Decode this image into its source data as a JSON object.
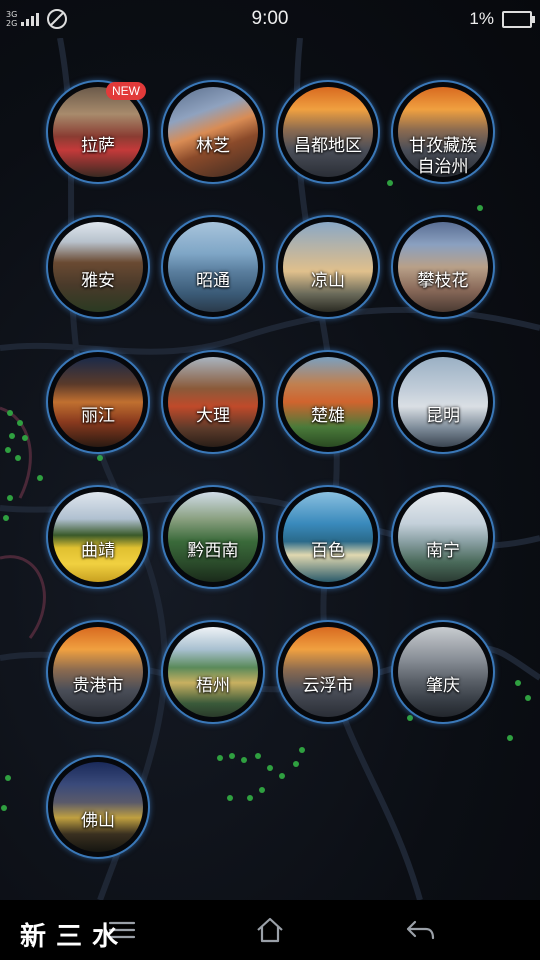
{
  "status_bar": {
    "network_top": "3G",
    "network_bottom": "2G",
    "time": "9:00",
    "battery": "1%",
    "icons": [
      "signal-icon",
      "no-sim-icon",
      "battery-icon"
    ]
  },
  "cities": [
    {
      "name": "拉萨",
      "badge": "NEW",
      "scene": "market"
    },
    {
      "name": "林芝",
      "scene": "mountain"
    },
    {
      "name": "昌都地区",
      "scene": "city"
    },
    {
      "name": "甘孜藏族\n自治州",
      "scene": "city"
    },
    {
      "name": "雅安",
      "scene": "village"
    },
    {
      "name": "昭通",
      "scene": "lake"
    },
    {
      "name": "凉山",
      "scene": "sunsetlake"
    },
    {
      "name": "攀枝花",
      "scene": "town"
    },
    {
      "name": "丽江",
      "scene": "lantern"
    },
    {
      "name": "大理",
      "scene": "oldtown"
    },
    {
      "name": "楚雄",
      "scene": "canyon"
    },
    {
      "name": "昆明",
      "scene": "gull"
    },
    {
      "name": "曲靖",
      "scene": "canola"
    },
    {
      "name": "黔西南",
      "scene": "karst"
    },
    {
      "name": "百色",
      "scene": "bay"
    },
    {
      "name": "南宁",
      "scene": "river"
    },
    {
      "name": "贵港市",
      "scene": "city"
    },
    {
      "name": "梧州",
      "scene": "riverbank"
    },
    {
      "name": "云浮市",
      "scene": "city"
    },
    {
      "name": "肇庆",
      "scene": "monument"
    },
    {
      "name": "佛山",
      "scene": "nightcity"
    }
  ],
  "nav_bar": {
    "menu_icon": "menu-icon",
    "home_icon": "home-icon",
    "back_icon": "back-icon"
  },
  "watermark": "新三水"
}
